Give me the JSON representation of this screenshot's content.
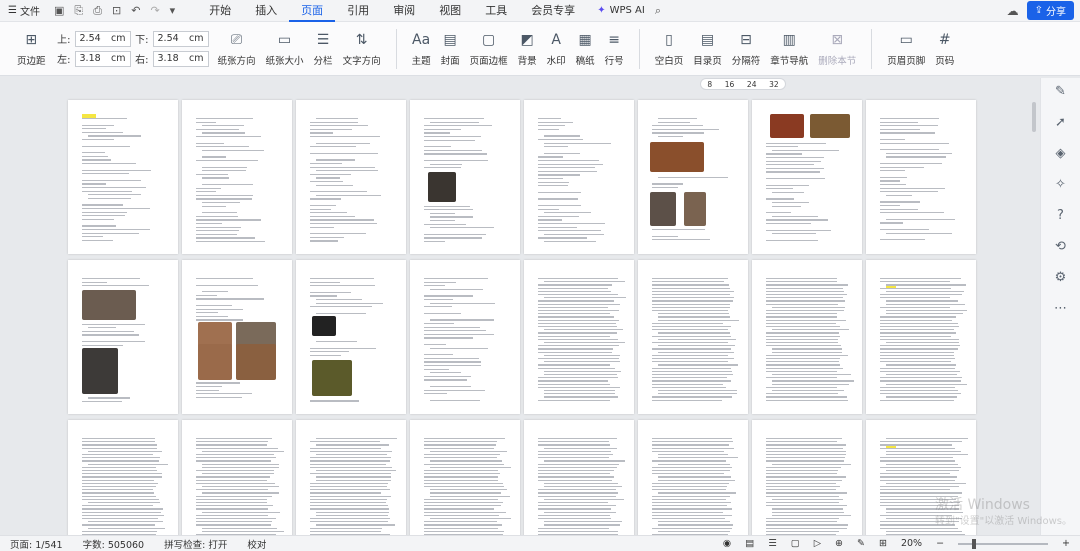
{
  "titlebar": {
    "file_label": "文件",
    "menu_tabs": [
      "开始",
      "插入",
      "页面",
      "引用",
      "审阅",
      "视图",
      "工具",
      "会员专享"
    ],
    "active_tab": "页面",
    "wps_ai": "WPS AI",
    "share": "分享"
  },
  "ribbon": {
    "margins": {
      "top_label": "上:",
      "top_value": "2.54",
      "bottom_label": "下:",
      "bottom_value": "2.54",
      "left_label": "左:",
      "left_value": "3.18",
      "right_label": "右:",
      "right_value": "3.18",
      "unit": "cm"
    },
    "margin_button": "页边距",
    "tools_a": [
      "纸张方向",
      "纸张大小",
      "分栏",
      "文字方向"
    ],
    "tools_b": [
      "主题",
      "封面",
      "页面边框",
      "背景",
      "水印",
      "稿纸",
      "行号"
    ],
    "tools_c": [
      "空白页",
      "目录页",
      "分隔符",
      "章节导航",
      "删除本节"
    ],
    "tools_d": [
      "页眉页脚",
      "页码"
    ]
  },
  "zoom_strip": [
    "8",
    "16",
    "24",
    "32"
  ],
  "status": {
    "page": "页面: 1/541",
    "words": "字数: 505060",
    "spell": "拼写检查: 打开",
    "proof": "校对",
    "zoom": "20%"
  },
  "watermark": {
    "line1": "激活 Windows",
    "line2": "转到\"设置\"以激活 Windows。"
  },
  "colors": {
    "accent": "#1a62e8",
    "highlight": "#f5e642"
  }
}
